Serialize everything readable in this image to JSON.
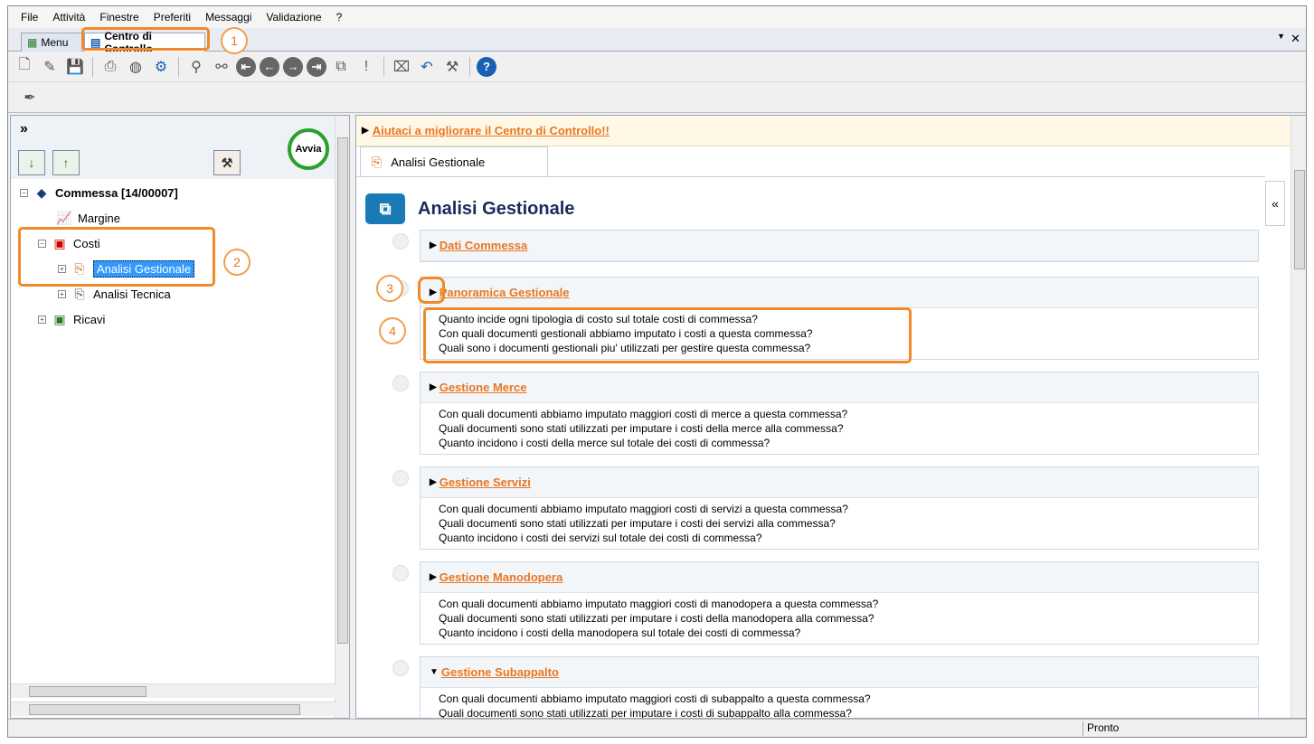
{
  "menubar": {
    "items": [
      "File",
      "Attività",
      "Finestre",
      "Preferiti",
      "Messaggi",
      "Validazione",
      "?"
    ]
  },
  "tabs": {
    "menu": "Menu",
    "active": "Centro di Controllo",
    "dropdown_icon": "▼",
    "close_icon": "✕"
  },
  "left": {
    "avvia_label": "Avvia",
    "tree": {
      "commessa": "Commessa [14/00007]",
      "margine": "Margine",
      "costi": "Costi",
      "analisi_gestionale": "Analisi Gestionale",
      "analisi_tecnica": "Analisi Tecnica",
      "ricavi": "Ricavi"
    }
  },
  "right": {
    "banner_link": "Aiutaci a migliorare il Centro di Controllo!!",
    "tab_label": "Analisi Gestionale",
    "collapse_glyph": "«",
    "page_title": "Analisi Gestionale",
    "sections": [
      {
        "title": "Dati Commessa",
        "expanded": false,
        "lines": []
      },
      {
        "title": "Panoramica Gestionale",
        "expanded": false,
        "lines": [
          "Quanto incide ogni tipologia di costo sul totale costi di commessa?",
          "Con quali documenti gestionali abbiamo imputato i costi a questa commessa?",
          "Quali sono i documenti gestionali piu' utilizzati per gestire questa commessa?"
        ]
      },
      {
        "title": "Gestione Merce",
        "expanded": false,
        "lines": [
          "Con quali documenti abbiamo imputato maggiori costi di merce a questa commessa?",
          "Quali documenti sono stati utilizzati per imputare i costi della merce alla commessa?",
          "Quanto incidono i costi della merce sul totale dei costi di commessa?"
        ]
      },
      {
        "title": "Gestione Servizi",
        "expanded": false,
        "lines": [
          "Con quali documenti abbiamo imputato maggiori costi di servizi a questa commessa?",
          "Quali documenti sono stati utilizzati per imputare i costi dei servizi alla commessa?",
          "Quanto incidono i costi dei servizi sul totale dei costi di commessa?"
        ]
      },
      {
        "title": "Gestione Manodopera",
        "expanded": false,
        "lines": [
          "Con quali documenti abbiamo imputato maggiori costi di manodopera a questa commessa?",
          "Quali documenti sono stati utilizzati per imputare i costi della manodopera alla commessa?",
          "Quanto incidono i costi della manodopera sul totale dei costi di commessa?"
        ]
      },
      {
        "title": "Gestione Subappalto",
        "expanded": true,
        "lines": [
          "Con quali documenti abbiamo imputato maggiori costi di subappalto a questa commessa?",
          "Quali documenti sono stati utilizzati per imputare i costi di subappalto alla commessa?"
        ]
      }
    ]
  },
  "status": {
    "text": "Pronto"
  },
  "callouts": [
    "1",
    "2",
    "3",
    "4"
  ],
  "colors": {
    "accent": "#e87722",
    "highlight": "#f08a28",
    "selection": "#3399ff"
  }
}
